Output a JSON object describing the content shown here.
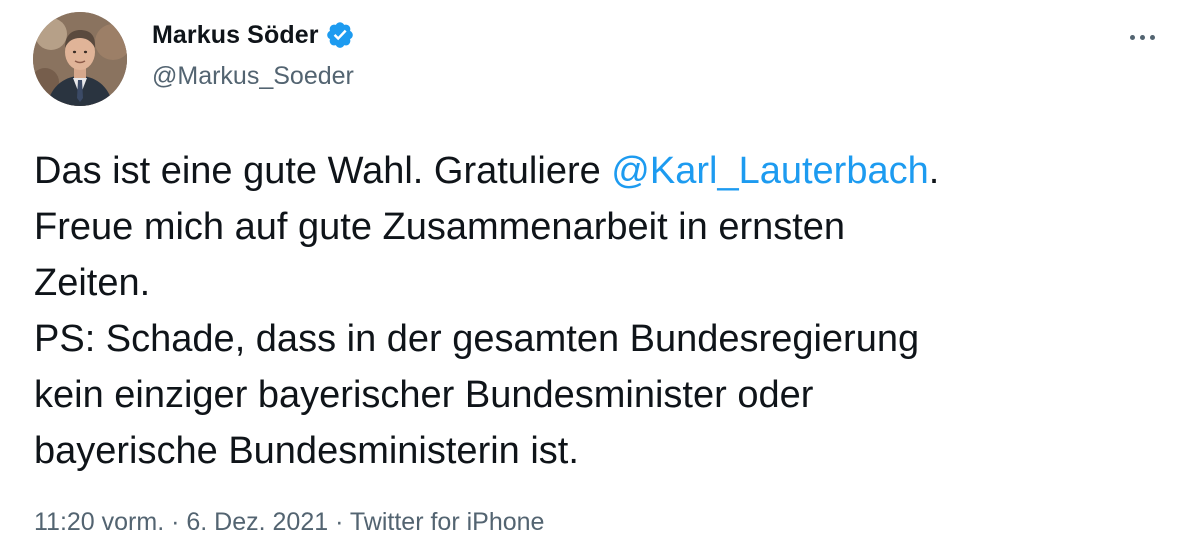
{
  "author": {
    "display_name": "Markus Söder",
    "handle": "@Markus_Soeder",
    "verified_icon": "verified-badge-icon",
    "verified_color": "#1d9bf0"
  },
  "menu": {
    "more_icon": "more-options-icon"
  },
  "tweet": {
    "line1_pre": "Das ist eine gute Wahl. Gratuliere ",
    "mention": "@Karl_Lauterbach",
    "line1_post": ".",
    "line2": "Freue mich auf gute Zusammenarbeit in ernsten",
    "line3": "Zeiten.",
    "line4": "PS: Schade, dass in der gesamten Bundesregierung",
    "line5": "kein einziger bayerischer Bundesminister oder",
    "line6": "bayerische Bundesministerin ist."
  },
  "meta": {
    "time": "11:20 vorm.",
    "sep1": " · ",
    "date": "6. Dez. 2021",
    "sep2": " · ",
    "source": "Twitter for iPhone"
  },
  "colors": {
    "text": "#0f1419",
    "secondary": "#536471",
    "link": "#1d9bf0"
  }
}
